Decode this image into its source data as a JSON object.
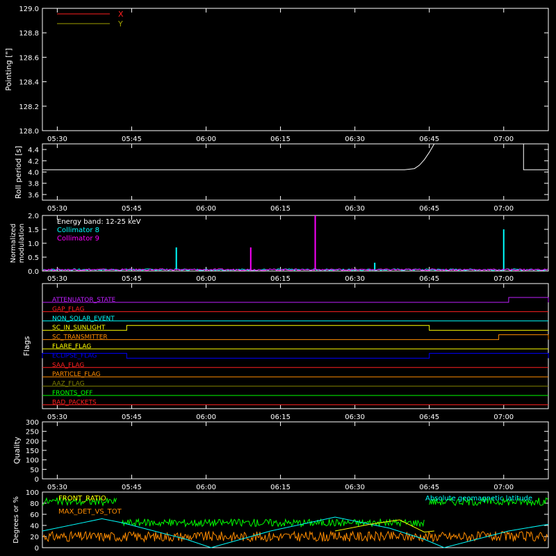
{
  "colors": {
    "background": "#000000",
    "axes": "#ffffff",
    "red": "#ff2020",
    "yellow": "#ffff00",
    "olive": "#a0a000",
    "cyan": "#00ffff",
    "magenta": "#ff00ff",
    "green": "#00ff00",
    "orange": "#ff8c00",
    "blue": "#0000ff",
    "purple": "#c020ff",
    "brown": "#808000"
  },
  "time_ticks": [
    "05:30",
    "05:45",
    "06:00",
    "06:15",
    "06:30",
    "06:45",
    "07:00"
  ],
  "chart_data": [
    {
      "type": "line",
      "panel": "pointing",
      "ylabel": "Pointing [\"]",
      "ylim": [
        128.0,
        129.0
      ],
      "yticks": [
        "128.0",
        "128.2",
        "128.4",
        "128.6",
        "128.8",
        "129.0"
      ],
      "legend": [
        "X",
        "Y"
      ],
      "legend_placement": "top-left",
      "series": [
        {
          "name": "X",
          "color": "red",
          "values": []
        },
        {
          "name": "Y",
          "color": "olive",
          "values": []
        }
      ]
    },
    {
      "type": "line",
      "panel": "roll",
      "ylabel": "Roll period [s]",
      "ylim": [
        3.5,
        4.5
      ],
      "yticks": [
        "3.6",
        "3.8",
        "4.0",
        "4.2",
        "4.4"
      ],
      "series": [
        {
          "color": "axes",
          "points": [
            [
              "05:27",
              4.04
            ],
            [
              "06:40",
              4.04
            ],
            [
              "06:42",
              4.06
            ],
            [
              "06:43",
              4.12
            ],
            [
              "06:44",
              4.22
            ],
            [
              "06:45",
              4.35
            ],
            [
              "06:46",
              4.5
            ]
          ],
          "points_b": [
            [
              "07:04",
              4.5
            ],
            [
              "07:04",
              4.04
            ],
            [
              "07:09",
              4.04
            ]
          ]
        }
      ]
    },
    {
      "type": "line",
      "panel": "modulation",
      "ylabel": "Normalized modulation",
      "ylim": [
        0,
        2.0
      ],
      "yticks": [
        "0.0",
        "0.5",
        "1.0",
        "1.5",
        "2.0"
      ],
      "annotation": "Energy band: 12-25 keV",
      "legend": [
        "Collimator 8",
        "Collimator 9"
      ],
      "series": [
        {
          "name": "Collimator 8",
          "color": "cyan",
          "baseline": 0.05,
          "spikes": [
            [
              "05:54",
              0.85
            ],
            [
              "06:34",
              0.3
            ],
            [
              "07:00",
              1.5
            ]
          ]
        },
        {
          "name": "Collimator 9",
          "color": "magenta",
          "baseline": 0.05,
          "spikes": [
            [
              "06:09",
              0.85
            ],
            [
              "06:22",
              2.0
            ]
          ]
        }
      ]
    },
    {
      "type": "line",
      "panel": "flags",
      "ylabel": "Flags",
      "flags": [
        {
          "label": "ATTENUATOR_STATE",
          "color": "purple",
          "high": [
            [
              "07:01",
              "07:09"
            ]
          ]
        },
        {
          "label": "GAP_FLAG",
          "color": "red",
          "high": []
        },
        {
          "label": "NON_SOLAR_EVENT",
          "color": "cyan",
          "high": []
        },
        {
          "label": "SC_IN_SUNLIGHT",
          "color": "yellow",
          "high": [
            [
              "05:44",
              "06:45"
            ]
          ]
        },
        {
          "label": "SC_TRANSMITTER",
          "color": "orange",
          "high": [
            [
              "06:59",
              "07:09"
            ]
          ]
        },
        {
          "label": "FLARE_FLAG",
          "color": "yellow",
          "high": []
        },
        {
          "label": "ECLIPSE_FLAG",
          "color": "blue",
          "high": [
            [
              "05:27",
              "05:44"
            ],
            [
              "06:45",
              "07:09"
            ]
          ]
        },
        {
          "label": "SAA_FLAG",
          "color": "red",
          "high": []
        },
        {
          "label": "PARTICLE_FLAG",
          "color": "orange",
          "high": []
        },
        {
          "label": "AAZ_FLAG",
          "color": "brown",
          "high": []
        },
        {
          "label": "FRONTS_OFF",
          "color": "green",
          "high": []
        },
        {
          "label": "BAD_PACKETS",
          "color": "red",
          "high": []
        }
      ]
    },
    {
      "type": "line",
      "panel": "quality",
      "ylabel": "Quality",
      "ylim": [
        0,
        300
      ],
      "yticks": [
        "0",
        "50",
        "100",
        "150",
        "200",
        "250",
        "300"
      ],
      "series": [
        {
          "color": "axes",
          "values": []
        }
      ]
    },
    {
      "type": "line",
      "panel": "bottom",
      "ylabel": "Degrees or %",
      "ylim": [
        0,
        100
      ],
      "yticks": [
        "0",
        "20",
        "40",
        "60",
        "80",
        "100"
      ],
      "legend": [
        "FRONT_RATIO",
        "MAX_DET_VS_TOT",
        "Absolute geomagnetic latitude"
      ],
      "series": [
        {
          "name": "FRONT_RATIO",
          "color": "green",
          "segments": [
            [
              "05:27",
              "05:42",
              83
            ],
            [
              "05:43",
              "06:44",
              45
            ],
            [
              "06:45",
              "07:09",
              83
            ]
          ]
        },
        {
          "name": "MAX_DET_VS_TOT",
          "color": "orange",
          "level": 20
        },
        {
          "name": "Absolute geomagnetic latitude",
          "color": "cyan",
          "points": [
            [
              "05:27",
              30
            ],
            [
              "05:39",
              52
            ],
            [
              "05:43",
              45
            ],
            [
              "05:56",
              15
            ],
            [
              "06:01",
              0
            ],
            [
              "06:13",
              30
            ],
            [
              "06:26",
              55
            ],
            [
              "06:37",
              35
            ],
            [
              "06:44",
              15
            ],
            [
              "06:48",
              0
            ],
            [
              "07:01",
              30
            ],
            [
              "07:09",
              42
            ]
          ]
        },
        {
          "name": "",
          "color": "yellow",
          "points": [
            [
              "06:26",
              30
            ],
            [
              "06:33",
              42
            ],
            [
              "06:39",
              50
            ],
            [
              "06:44",
              28
            ],
            [
              "06:46",
              30
            ]
          ]
        }
      ]
    }
  ]
}
